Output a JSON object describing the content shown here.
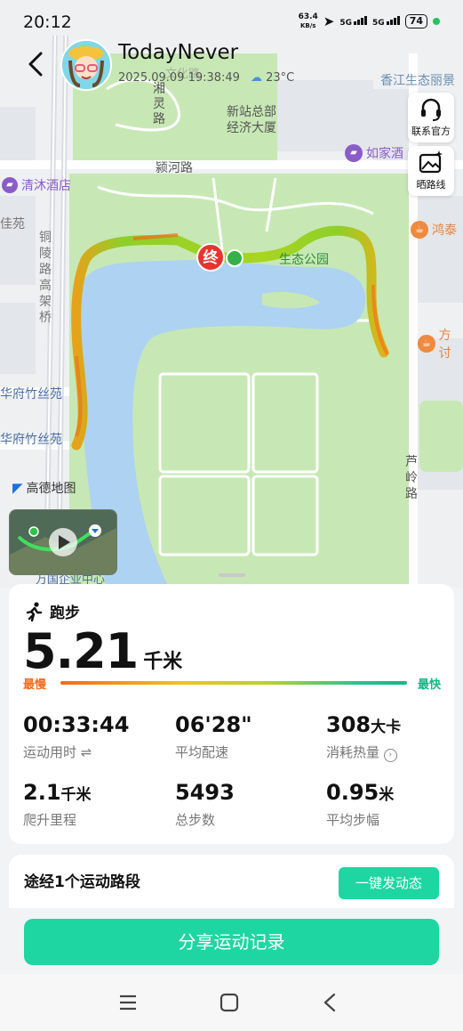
{
  "status_bar": {
    "time": "20:12",
    "net_speed_value": "63.4",
    "net_speed_unit": "KB/s",
    "signal1": "5G",
    "signal2": "5G",
    "battery": "74"
  },
  "header": {
    "username": "TodayNever",
    "datetime": "2025.09.09 19:38:49",
    "temperature": "23°C"
  },
  "side_buttons": {
    "contact": "联系官方",
    "share_route": "晒路线"
  },
  "map": {
    "labels": {
      "wenhua_road": "文化路",
      "xiangling_road": "湘灵路",
      "xinzhan": "新站总部经济大厦",
      "xinzhan_line1": "新站总部",
      "xinzhan_line2": "经济大厦",
      "xiangjiang": "香江生态丽景",
      "yinghe_road": "颍河路",
      "qingmu_hotel": "清沐酒店",
      "rujia": "如家酒",
      "gui_yuan": "佳苑",
      "tongling_viaduct": "铜陵路高架桥",
      "hongtai": "鸿泰",
      "fangtao": "方讨",
      "eco_park": "生态公园",
      "zhusi_yuan1": "华府竹丝苑",
      "zhusi_yuan2": "华府竹丝苑",
      "luling_road": "芦岭路",
      "wanguo": "万国企业中心"
    },
    "end_marker": "终",
    "provider": "高德地图"
  },
  "activity": {
    "type": "跑步",
    "distance": "5.21",
    "distance_unit": "千米",
    "pace_slow": "最慢",
    "pace_fast": "最快",
    "stats": [
      {
        "value": "00:33:44",
        "unit": "",
        "label": "运动用时"
      },
      {
        "value": "06'28\"",
        "unit": "",
        "label": "平均配速"
      },
      {
        "value": "308",
        "unit": "大卡",
        "label": "消耗热量"
      },
      {
        "value": "2.1",
        "unit": "千米",
        "label": "爬升里程"
      },
      {
        "value": "5493",
        "unit": "",
        "label": "总步数"
      },
      {
        "value": "0.95",
        "unit": "米",
        "label": "平均步幅"
      }
    ]
  },
  "route": {
    "title": "途经1个运动路段",
    "post_button": "一键发动态"
  },
  "share_button": "分享运动记录",
  "colors": {
    "accent": "#1ed6a2",
    "slow": "#f26b1d",
    "fast": "#12b886"
  }
}
